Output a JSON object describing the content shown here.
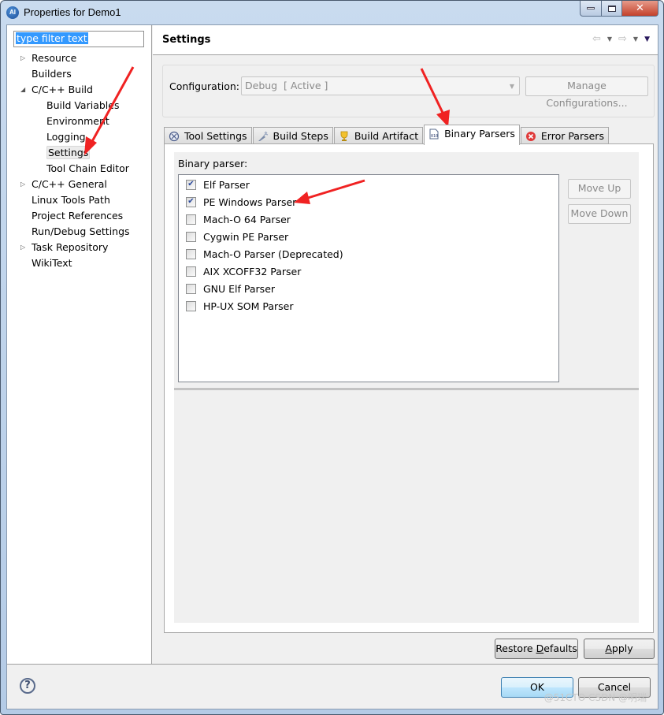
{
  "window": {
    "title": "Properties for Demo1",
    "app_icon_text": "AI",
    "controls": {
      "minimize": "minimize",
      "maximize": "maximize",
      "close": "✕"
    }
  },
  "sidebar": {
    "filter_placeholder": "type filter text",
    "filter_value": "type filter text",
    "items": [
      {
        "label": "Resource",
        "level": 0,
        "expander": "collapsed"
      },
      {
        "label": "Builders",
        "level": 0,
        "expander": "none"
      },
      {
        "label": "C/C++ Build",
        "level": 0,
        "expander": "expanded"
      },
      {
        "label": "Build Variables",
        "level": 1,
        "expander": "none"
      },
      {
        "label": "Environment",
        "level": 1,
        "expander": "none"
      },
      {
        "label": "Logging",
        "level": 1,
        "expander": "none"
      },
      {
        "label": "Settings",
        "level": 1,
        "expander": "none",
        "selected": true
      },
      {
        "label": "Tool Chain Editor",
        "level": 1,
        "expander": "none"
      },
      {
        "label": "C/C++ General",
        "level": 0,
        "expander": "collapsed"
      },
      {
        "label": "Linux Tools Path",
        "level": 0,
        "expander": "none"
      },
      {
        "label": "Project References",
        "level": 0,
        "expander": "none"
      },
      {
        "label": "Run/Debug Settings",
        "level": 0,
        "expander": "none"
      },
      {
        "label": "Task Repository",
        "level": 0,
        "expander": "collapsed"
      },
      {
        "label": "WikiText",
        "level": 0,
        "expander": "none"
      }
    ]
  },
  "header": {
    "title": "Settings",
    "nav": {
      "back": "⇦",
      "forward": "⇨",
      "dropdown": "▼",
      "menu": "▼"
    }
  },
  "configuration": {
    "label": "Configuration:",
    "value": "Debug  [ Active ]",
    "manage_button": "Manage Configurations..."
  },
  "tabs": [
    {
      "label": "Tool Settings",
      "icon": "tool-settings-icon",
      "active": false
    },
    {
      "label": "Build Steps",
      "icon": "build-steps-icon",
      "active": false
    },
    {
      "label": "Build Artifact",
      "icon": "trophy-icon",
      "active": false
    },
    {
      "label": "Binary Parsers",
      "icon": "binary-file-icon",
      "active": true
    },
    {
      "label": "Error Parsers",
      "icon": "error-icon",
      "active": false
    }
  ],
  "binary_parsers": {
    "label": "Binary parser:",
    "items": [
      {
        "label": "Elf Parser",
        "checked": true
      },
      {
        "label": "PE Windows Parser",
        "checked": true
      },
      {
        "label": "Mach-O 64 Parser",
        "checked": false
      },
      {
        "label": "Cygwin PE Parser",
        "checked": false
      },
      {
        "label": "Mach-O Parser (Deprecated)",
        "checked": false
      },
      {
        "label": "AIX XCOFF32 Parser",
        "checked": false
      },
      {
        "label": "GNU Elf Parser",
        "checked": false
      },
      {
        "label": "HP-UX SOM Parser",
        "checked": false
      }
    ],
    "move_up": "Move Up",
    "move_down": "Move Down"
  },
  "buttons": {
    "restore_defaults_pre": "Restore ",
    "restore_defaults_mnemonic": "D",
    "restore_defaults_post": "efaults",
    "apply_mnemonic": "A",
    "apply_post": "pply",
    "ok": "OK",
    "cancel": "Cancel"
  },
  "footer": {
    "help_icon": "?",
    "watermark": "@51CTO CSDN @明瑞"
  },
  "annotation_color": "#f02222"
}
